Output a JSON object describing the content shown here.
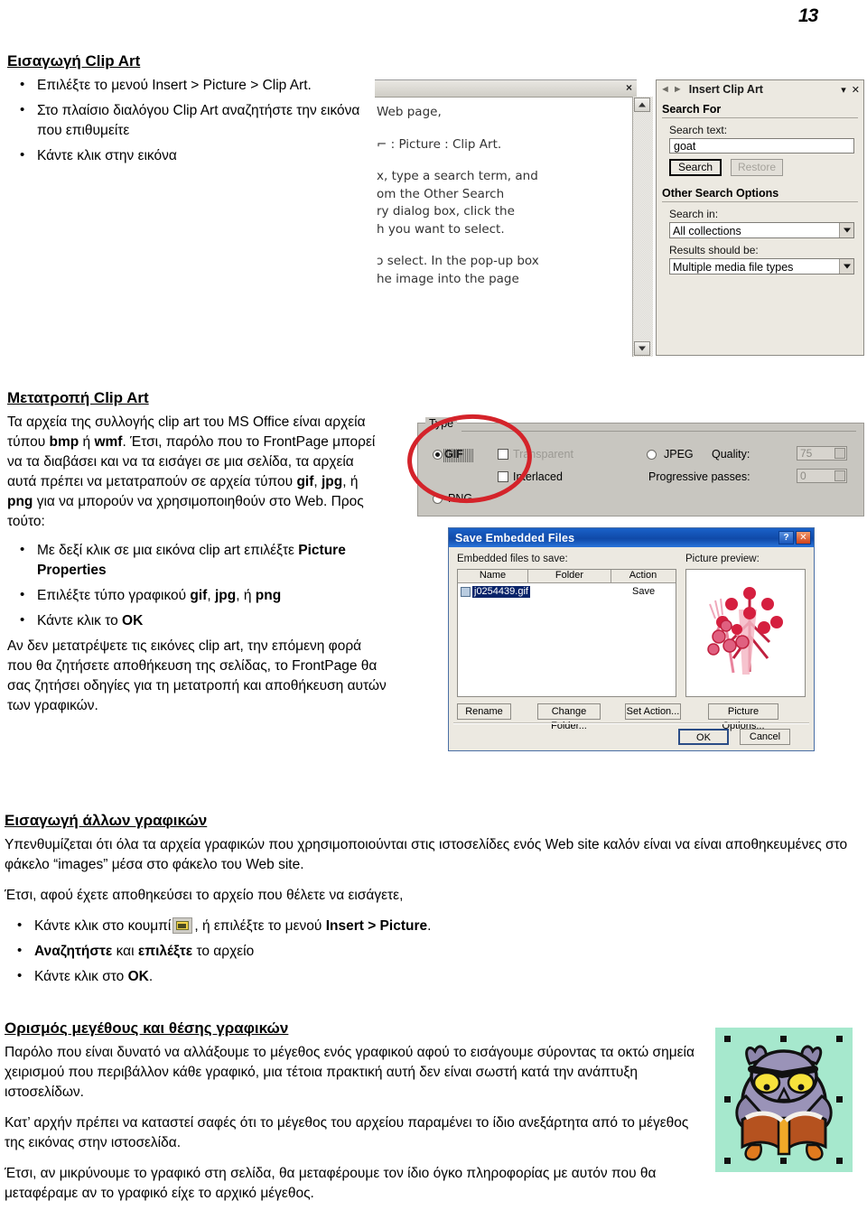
{
  "page": {
    "number": "13"
  },
  "sections": {
    "insert_clipart": {
      "heading": "Εισαγωγή Clip Art",
      "bullets": [
        "Επιλέξτε το μενού Insert > Picture > Clip Art.",
        "Στο πλαίσιο διαλόγου Clip Art αναζητήστε την εικόνα που επιθυμείτε",
        "Κάντε κλικ στην εικόνα"
      ]
    },
    "convert_clipart": {
      "heading": "Μετατροπή Clip Art",
      "paragraph1_a": "Τα αρχεία της συλλογής clip art του MS Office είναι αρχεία τύπου ",
      "paragraph1_b": "bmp",
      "paragraph1_c": " ή ",
      "paragraph1_d": "wmf",
      "paragraph1_e": ". Έτσι, παρόλο που το FrontPage μπορεί να τα διαβάσει και να τα εισάγει σε μια σελίδα, τα αρχεία αυτά πρέπει να μετατραπούν σε αρχεία τύπου ",
      "paragraph1_f": "gif",
      "paragraph1_g": ", ",
      "paragraph1_h": "jpg",
      "paragraph1_i": ", ή ",
      "paragraph1_j": "png",
      "paragraph1_k": " για να μπορούν να χρησιμοποιηθούν στο Web. Προς τούτο:",
      "bullet1_a": "Με δεξί κλικ σε μια εικόνα clip art επιλέξτε ",
      "bullet1_b": "Picture Properties",
      "bullet2_a": "Επιλέξτε τύπο γραφικού ",
      "bullet2_b": "gif",
      "bullet2_c": ", ",
      "bullet2_d": "jpg",
      "bullet2_e": ", ή ",
      "bullet2_f": "png",
      "bullet3_a": "Κάντε κλικ το ",
      "bullet3_b": "OK",
      "paragraph2": "Αν δεν μετατρέψετε τις εικόνες clip art, την επόμενη φορά που θα ζητήσετε αποθήκευση της σελίδας, το FrontPage θα σας ζητήσει οδηγίες για τη μετατροπή και αποθήκευση αυτών των γραφικών."
    },
    "other_graphics": {
      "heading": "Εισαγωγή άλλων γραφικών",
      "paragraph1": "Υπενθυμίζεται ότι όλα τα αρχεία γραφικών που χρησιμοποιούνται στις ιστοσελίδες ενός Web site καλόν είναι να είναι αποθηκευμένες στο φάκελο “images” μέσα στο φάκελο του Web site.",
      "paragraph2": "Έτσι, αφού έχετε αποθηκεύσει το αρχείο που θέλετε να εισάγετε,",
      "bullet1_a": "Κάντε κλικ στο κουμπί",
      "bullet1_b": ", ή επιλέξτε το μενού ",
      "bullet1_c": "Insert > Picture",
      "bullet1_d": ".",
      "bullet2_a": "Αναζητήστε",
      "bullet2_b": " και ",
      "bullet2_c": "επιλέξτε",
      "bullet2_d": " το αρχείο",
      "bullet3_a": "Κάντε κλικ στο ",
      "bullet3_b": "OK",
      "bullet3_c": "."
    },
    "size_position": {
      "heading": "Ορισμός μεγέθους και θέσης γραφικών",
      "paragraph1": "Παρόλο που είναι δυνατό να αλλάξουμε το μέγεθος ενός γραφικού αφού το εισάγουμε σύροντας τα οκτώ σημεία χειρισμού που περιβάλλον κάθε γραφικό, μια τέτοια πρακτική αυτή δεν είναι σωστή κατά την ανάπτυξη ιστοσελίδων.",
      "paragraph2": "Κατ’ αρχήν πρέπει να καταστεί σαφές ότι το μέγεθος του αρχείου παραμένει το ίδιο ανεξάρτητα από το μέγεθος της εικόνας στην ιστοσελίδα.",
      "paragraph3": "Έτσι, αν μικρύνουμε το γραφικό στη σελίδα, θα μεταφέρουμε τον ίδιο όγκο πληροφορίας με αυτόν που θα μεταφέραμε αν το γραφικό είχε το αρχικό μέγεθος."
    }
  },
  "screenshot_clipart": {
    "document_window": {
      "close_label": "×",
      "lines": [
        "Web page,",
        "⌐ : Picture : Clip Art.",
        "x, type a search term, and\nom the Other Search\nry dialog box, click the\nh you want to select.",
        "ɔ select. In the pop-up box\nhe image into the page"
      ]
    },
    "task_pane": {
      "back_icon": "◄",
      "forward_icon": "►",
      "title": "Insert Clip Art",
      "dropdown_icon": "▾",
      "close_icon": "✕",
      "search_for_heading": "Search For",
      "search_text_label": "Search text:",
      "search_text_value": "goat",
      "search_button": "Search",
      "restore_button": "Restore",
      "other_options_heading": "Other Search Options",
      "search_in_label": "Search in:",
      "search_in_value": "All collections",
      "results_label": "Results should be:",
      "results_value": "Multiple media file types"
    }
  },
  "screenshot_type": {
    "legend": "Type",
    "gif_label": "GIF",
    "png_label": "PNG",
    "transparent_label": "Transparent",
    "interlaced_label": "Interlaced",
    "jpeg_label": "JPEG",
    "quality_label": "Quality:",
    "quality_value": "75",
    "progressive_label": "Progressive passes:",
    "progressive_value": "0",
    "selected_type": "GIF",
    "annotation_color": "#d4232a"
  },
  "screenshot_save": {
    "title": "Save Embedded Files",
    "help_button": "?",
    "close_button": "✕",
    "list_label": "Embedded files to save:",
    "preview_label": "Picture preview:",
    "columns": [
      "Name",
      "Folder",
      "Action"
    ],
    "rows": [
      {
        "name": "j0254439.gif",
        "folder": "",
        "action": "Save"
      }
    ],
    "buttons": [
      "Rename",
      "Change Folder...",
      "Set Action...",
      "Picture Options..."
    ],
    "ok_button": "OK",
    "cancel_button": "Cancel"
  },
  "owl_image": {
    "alt": "owl reading a book clip art",
    "background_color": "#a6e8cd",
    "handle_color": "#111111",
    "handle_count": 8
  }
}
